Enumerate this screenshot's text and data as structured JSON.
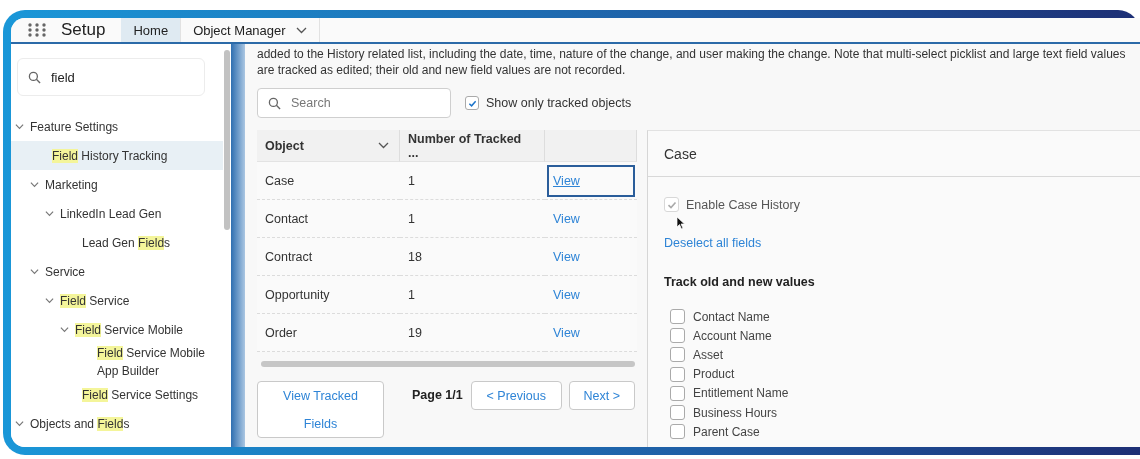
{
  "app": {
    "title": "Setup"
  },
  "nav_tabs": [
    {
      "label": "Home",
      "selected": true,
      "has_menu": false
    },
    {
      "label": "Object Manager",
      "selected": false,
      "has_menu": true
    }
  ],
  "sidebar": {
    "search": {
      "value": "field"
    },
    "tree": [
      {
        "parts": [
          {
            "text": "Feature Settings",
            "match": false
          }
        ],
        "expanded": true,
        "selected": false,
        "children": [
          {
            "parts": [
              {
                "text": "Field",
                "match": true
              },
              {
                "text": " History Tracking",
                "match": false
              }
            ],
            "selected": true
          },
          {
            "parts": [
              {
                "text": "Marketing",
                "match": false
              }
            ],
            "expanded": true,
            "selected": false,
            "children": [
              {
                "parts": [
                  {
                    "text": "LinkedIn Lead Gen",
                    "match": false
                  }
                ],
                "expanded": true,
                "selected": false,
                "children": [
                  {
                    "parts": [
                      {
                        "text": "Lead Gen ",
                        "match": false
                      },
                      {
                        "text": "Field",
                        "match": true
                      },
                      {
                        "text": "s",
                        "match": false
                      }
                    ],
                    "selected": false
                  }
                ]
              }
            ]
          },
          {
            "parts": [
              {
                "text": "Service",
                "match": false
              }
            ],
            "expanded": true,
            "selected": false,
            "children": [
              {
                "parts": [
                  {
                    "text": "Field",
                    "match": true
                  },
                  {
                    "text": " Service",
                    "match": false
                  }
                ],
                "expanded": true,
                "selected": false,
                "children": [
                  {
                    "parts": [
                      {
                        "text": "Field",
                        "match": true
                      },
                      {
                        "text": " Service Mobile",
                        "match": false
                      }
                    ],
                    "expanded": true,
                    "selected": false,
                    "children": [
                      {
                        "parts": [
                          {
                            "text": "Field",
                            "match": true
                          },
                          {
                            "text": " Service Mobile App Builder",
                            "match": false
                          }
                        ],
                        "selected": false
                      }
                    ]
                  },
                  {
                    "parts": [
                      {
                        "text": "Field",
                        "match": true
                      },
                      {
                        "text": " Service Settings",
                        "match": false
                      }
                    ],
                    "selected": false
                  }
                ]
              }
            ]
          }
        ]
      },
      {
        "parts": [
          {
            "text": "Objects and ",
            "match": false
          },
          {
            "text": "Field",
            "match": true
          },
          {
            "text": "s",
            "match": false
          }
        ],
        "expanded": true,
        "selected": false
      }
    ]
  },
  "description": "added to the History related list, including the date, time, nature of the change, and user making the change. Note that multi-select picklist and large text field values are tracked as edited; their old and new field values are not recorded.",
  "filter": {
    "search": {
      "placeholder": "Search"
    },
    "tracked_only": {
      "label": "Show only tracked objects",
      "checked": true
    }
  },
  "table": {
    "columns": [
      "Object",
      "Number of Tracked ..."
    ],
    "rows": [
      {
        "object": "Case",
        "count": "1",
        "action": "View",
        "focused": true
      },
      {
        "object": "Contact",
        "count": "1",
        "action": "View",
        "focused": false
      },
      {
        "object": "Contract",
        "count": "18",
        "action": "View",
        "focused": false
      },
      {
        "object": "Opportunity",
        "count": "1",
        "action": "View",
        "focused": false
      },
      {
        "object": "Order",
        "count": "19",
        "action": "View",
        "focused": false
      }
    ]
  },
  "pager": {
    "view_button": "View Tracked Fields",
    "page": "Page 1/1",
    "previous": "< Previous",
    "next": "Next >"
  },
  "detail": {
    "title": "Case",
    "enable": {
      "label": "Enable Case History",
      "checked": true,
      "disabled": true
    },
    "deselect_link": "Deselect all fields",
    "section_title": "Track old and new values",
    "fields": [
      {
        "label": "Contact Name",
        "checked": false
      },
      {
        "label": "Account Name",
        "checked": false
      },
      {
        "label": "Asset",
        "checked": false
      },
      {
        "label": "Product",
        "checked": false
      },
      {
        "label": "Entitlement Name",
        "checked": false
      },
      {
        "label": "Business Hours",
        "checked": false
      },
      {
        "label": "Parent Case",
        "checked": false
      }
    ]
  }
}
